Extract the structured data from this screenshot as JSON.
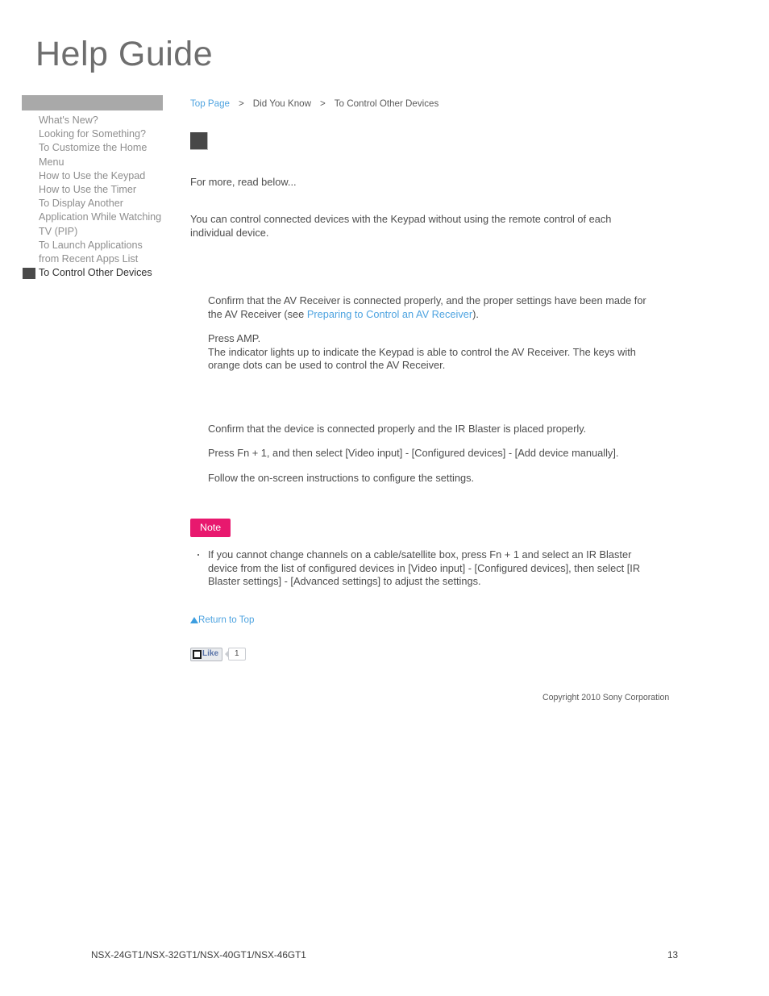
{
  "masthead": {
    "title": "Help Guide"
  },
  "sidebar": {
    "items": [
      {
        "label": "What's New?",
        "current": false
      },
      {
        "label": "Looking for Something?",
        "current": false
      },
      {
        "label": "To Customize the Home Menu",
        "current": false
      },
      {
        "label": "How to Use the Keypad",
        "current": false
      },
      {
        "label": "How to Use the Timer",
        "current": false
      },
      {
        "label": "To Display Another Application While Watching TV (PIP)",
        "current": false
      },
      {
        "label": "To Launch Applications from Recent Apps List",
        "current": false
      },
      {
        "label": "To Control Other Devices",
        "current": true
      }
    ]
  },
  "breadcrumb": {
    "top_page": "Top Page",
    "separator": ">",
    "section": "Did You Know",
    "current": "To Control Other Devices"
  },
  "content": {
    "intro_line": "For more, read below...",
    "intro_paragraph": "You can control connected devices with the Keypad without using the remote control of each individual device.",
    "section_av": {
      "para1_before_link": "Confirm that the AV Receiver is connected properly, and the proper settings have been made for the AV Receiver (see ",
      "para1_link": "Preparing to Control an AV Receiver",
      "para1_after_link": ").",
      "para2_line1": "Press AMP.",
      "para2_line2": "The indicator lights up to indicate the Keypad is able to control the AV Receiver. The keys with orange dots can be used to control the AV Receiver."
    },
    "section_device": {
      "para1": "Confirm that the device is connected properly and the IR Blaster is placed properly.",
      "para2": "Press Fn + 1, and then select [Video input] - [Configured devices] - [Add device manually].",
      "para3": "Follow the on-screen instructions to configure the settings."
    },
    "note": {
      "badge": "Note",
      "items": [
        "If you cannot change channels on a cable/satellite box, press Fn + 1 and select an IR Blaster device from the list of configured devices in [Video input] - [Configured devices], then select [IR Blaster settings] - [Advanced settings] to adjust the settings."
      ]
    },
    "return_to_top": "Return to Top",
    "like_widget": {
      "label": "Like",
      "count": "1"
    },
    "copyright": "Copyright 2010 Sony Corporation"
  },
  "page_footer": {
    "models": "NSX-24GT1/NSX-32GT1/NSX-40GT1/NSX-46GT1",
    "page_number": "13"
  }
}
